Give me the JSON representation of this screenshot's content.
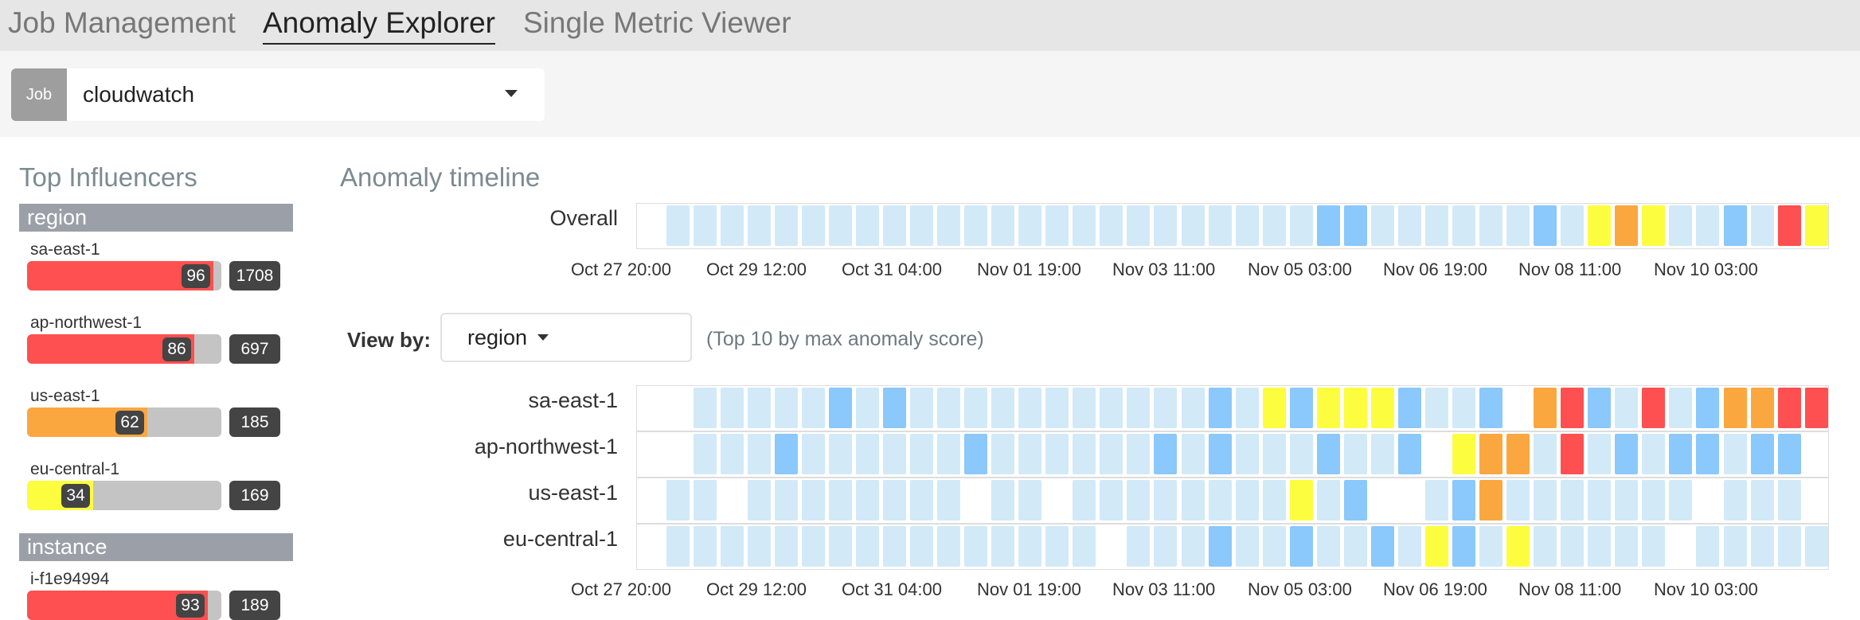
{
  "tabs": [
    {
      "label": "Job Management",
      "active": false
    },
    {
      "label": "Anomaly Explorer",
      "active": true
    },
    {
      "label": "Single Metric Viewer",
      "active": false
    }
  ],
  "job": {
    "tag": "Job",
    "value": "cloudwatch"
  },
  "influencers": {
    "title": "Top Influencers",
    "groups": [
      {
        "name": "region",
        "items": [
          {
            "label": "sa-east-1",
            "score": 96,
            "count": 1708,
            "color": "#fe5050"
          },
          {
            "label": "ap-northwest-1",
            "score": 86,
            "count": 697,
            "color": "#fe5050"
          },
          {
            "label": "us-east-1",
            "score": 62,
            "count": 185,
            "color": "#fba740"
          },
          {
            "label": "eu-central-1",
            "score": 34,
            "count": 169,
            "color": "#fdfd40"
          }
        ]
      },
      {
        "name": "instance",
        "items": [
          {
            "label": "i-f1e94994",
            "score": 93,
            "count": 189,
            "color": "#fe5050"
          }
        ]
      }
    ]
  },
  "timeline": {
    "title": "Anomaly timeline",
    "overall_label": "Overall",
    "view_by_label": "View by:",
    "view_by_value": "region",
    "view_by_note": "(Top 10 by max anomaly score)",
    "axis_labels": [
      "Oct 27 20:00",
      "Oct 29 12:00",
      "Oct 31 04:00",
      "Nov 01 19:00",
      "Nov 03 11:00",
      "Nov 05 03:00",
      "Nov 06 19:00",
      "Nov 08 11:00",
      "Nov 10 03:00"
    ],
    "legend_colors": {
      "0": "#ffffff",
      "1": "#d2e9f7",
      "2": "#8bc8fb",
      "3": "#fdfd40",
      "4": "#fba740",
      "5": "#fe5050"
    },
    "overall": "01111111111111111111111112211111121343112153",
    "swimlanes": [
      {
        "label": "sa-east-1",
        "cells": "00111112121111111111121323332112045215124455"
      },
      {
        "label": "ap-northwest-1",
        "cells": "00111211111121111112121112112034415121221220"
      },
      {
        "label": "us-east-1",
        "cells": "01101111111101101111111131200124111111101110"
      },
      {
        "label": "eu-central-1",
        "cells": "01111111111111111011121121121321311111011111"
      }
    ]
  }
}
